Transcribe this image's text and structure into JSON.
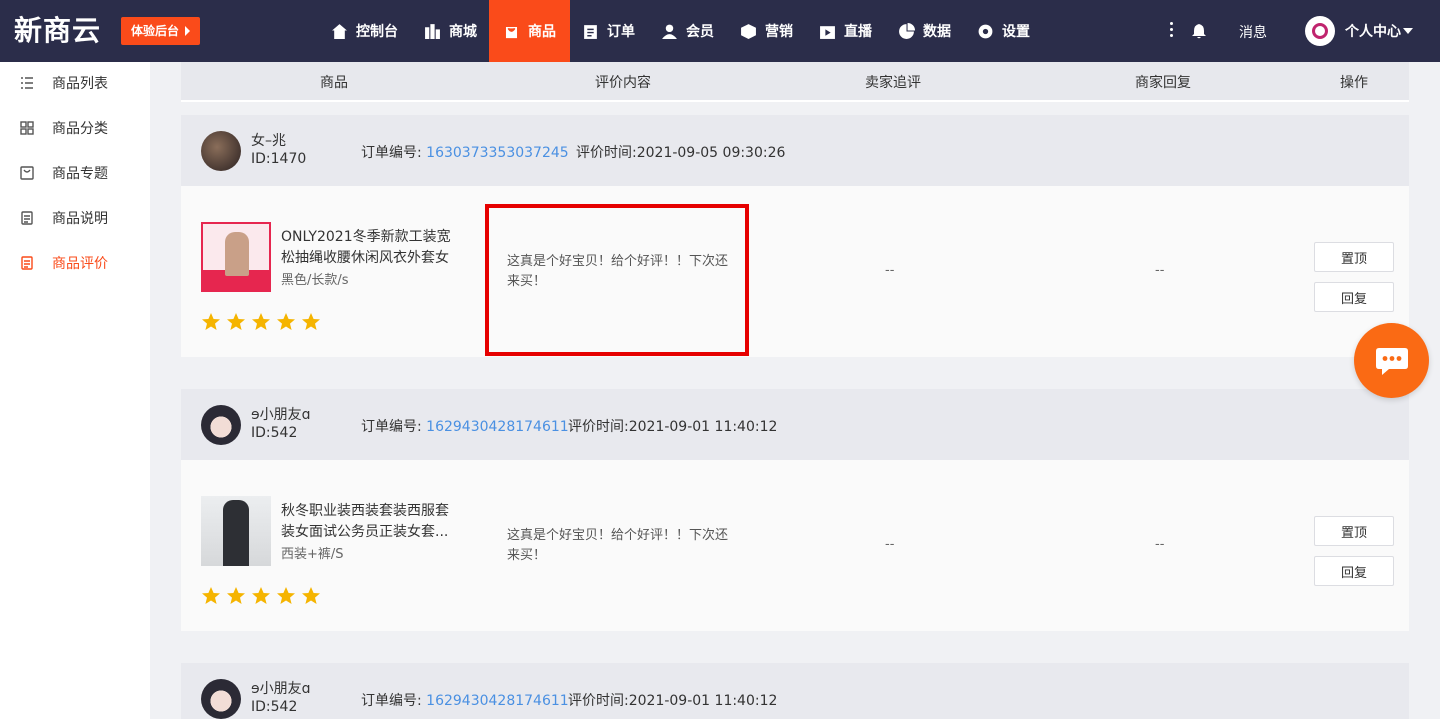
{
  "app": {
    "logo": "新商云",
    "trial_button": "体验后台"
  },
  "nav": [
    {
      "label": "控制台",
      "icon": "home-icon"
    },
    {
      "label": "商城",
      "icon": "store-icon"
    },
    {
      "label": "商品",
      "icon": "bag-icon",
      "active": true
    },
    {
      "label": "订单",
      "icon": "clipboard-icon"
    },
    {
      "label": "会员",
      "icon": "user-icon"
    },
    {
      "label": "营销",
      "icon": "box-icon"
    },
    {
      "label": "直播",
      "icon": "live-icon"
    },
    {
      "label": "数据",
      "icon": "pie-chart-icon"
    },
    {
      "label": "设置",
      "icon": "gear-icon"
    }
  ],
  "topright": {
    "message": "消息",
    "personal_center": "个人中心"
  },
  "sidebar": [
    {
      "label": "商品列表",
      "icon": "list-icon"
    },
    {
      "label": "商品分类",
      "icon": "grid-icon"
    },
    {
      "label": "商品专题",
      "icon": "topic-icon"
    },
    {
      "label": "商品说明",
      "icon": "document-icon"
    },
    {
      "label": "商品评价",
      "icon": "review-icon",
      "active": true
    }
  ],
  "table": {
    "headers": [
      "商品",
      "评价内容",
      "卖家追评",
      "商家回复",
      "操作"
    ]
  },
  "labels": {
    "order_prefix": "订单编号: ",
    "time_prefix": "评价时间:"
  },
  "reviews": [
    {
      "user": "女–兆",
      "id": "ID:1470",
      "order_no": "1630373353037245",
      "time": "2021-09-05 09:30:26",
      "product_title": "ONLY2021冬季新款工装宽松抽绳收腰休闲风衣外套女",
      "spec": "黑色/长款/s",
      "rating": 5,
      "content": "这真是个好宝贝！给个好评！！下次还来买！",
      "seller_followup": "--",
      "merchant_reply": "--",
      "actions": [
        "置顶",
        "回复"
      ]
    },
    {
      "user": "ɘ小朋友ɑ",
      "id": "ID:542",
      "order_no": "1629430428174611",
      "time": "2021-09-01 11:40:12",
      "product_title": "秋冬职业装西装套装西服套装女面试公务员正装女套...",
      "spec": "西装+裤/S",
      "rating": 5,
      "content": "这真是个好宝贝！给个好评！！下次还来买！",
      "seller_followup": "--",
      "merchant_reply": "--",
      "actions": [
        "置顶",
        "回复"
      ]
    },
    {
      "user": "ɘ小朋友ɑ",
      "id": "ID:542",
      "order_no": "1629430428174611",
      "time": "2021-09-01 11:40:12"
    }
  ],
  "colors": {
    "accent": "#fa4b1a",
    "topbar": "#2b2d4a",
    "link": "#4a90e2",
    "star": "#f5b400",
    "highlight": "#e60000"
  }
}
